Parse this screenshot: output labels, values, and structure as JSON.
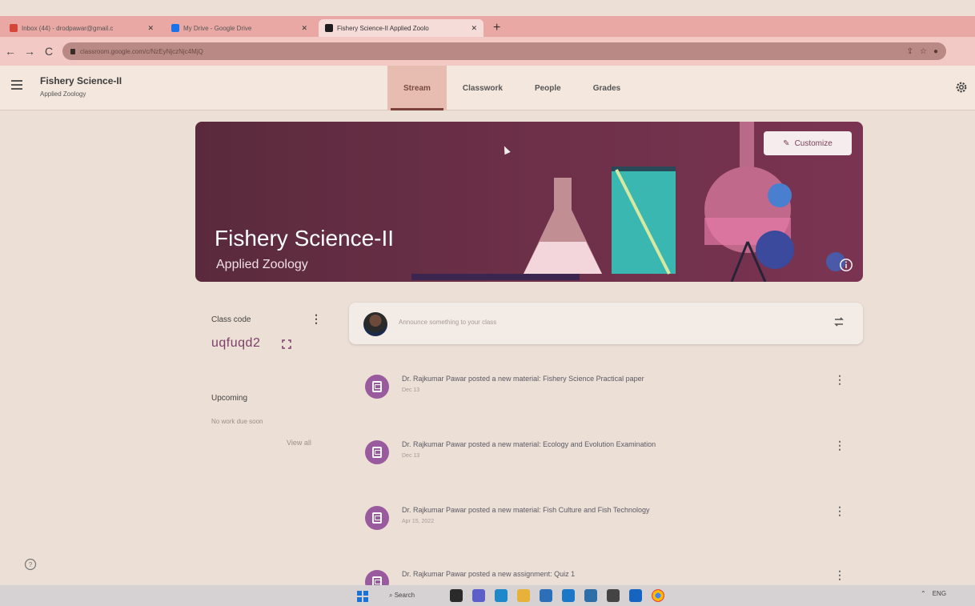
{
  "browser": {
    "tabs": [
      {
        "title": "Inbox (44) - drodpawar@gmail.c",
        "active": false,
        "favicon_color": "#d44638"
      },
      {
        "title": "My Drive - Google Drive",
        "active": false,
        "favicon_color": "#1a73e8"
      },
      {
        "title": "Fishery Science-II Applied Zoolo",
        "active": true,
        "favicon_color": "#1e1e1e"
      }
    ],
    "new_tab": "+",
    "url": "classroom.google.com/c/NzEyNjczNjc4MjQ",
    "nav": {
      "back": "←",
      "forward": "→",
      "reload": "C"
    }
  },
  "header": {
    "class_title": "Fishery Science-II",
    "class_subtitle": "Applied Zoology",
    "tabs": [
      {
        "label": "Stream",
        "active": true
      },
      {
        "label": "Classwork",
        "active": false
      },
      {
        "label": "People",
        "active": false
      },
      {
        "label": "Grades",
        "active": false
      }
    ]
  },
  "banner": {
    "title": "Fishery Science-II",
    "subtitle": "Applied Zoology",
    "customize_label": "Customize"
  },
  "class_code": {
    "label": "Class code",
    "value": "uqfuqd2"
  },
  "upcoming": {
    "title": "Upcoming",
    "empty_text": "No work due soon",
    "view_all": "View all"
  },
  "stream": {
    "announce_placeholder": "Announce something to your class",
    "posts": [
      {
        "title": "Dr. Rajkumar Pawar posted a new material: Fishery Science Practical paper",
        "date": "Dec 13"
      },
      {
        "title": "Dr. Rajkumar Pawar posted a new material: Ecology and Evolution Examination",
        "date": "Dec 13"
      },
      {
        "title": "Dr. Rajkumar Pawar posted a new material: Fish Culture and Fish Technology",
        "date": "Apr 15, 2022"
      },
      {
        "title": "Dr. Rajkumar Pawar posted a new assignment: Quiz 1",
        "date": ""
      }
    ]
  },
  "taskbar": {
    "search_label": "Search",
    "tray": {
      "lang": "ENG"
    }
  },
  "colors": {
    "accent": "#7b3f6a",
    "banner_base": "#6b2f47",
    "post_icon": "#9a5a9e"
  }
}
